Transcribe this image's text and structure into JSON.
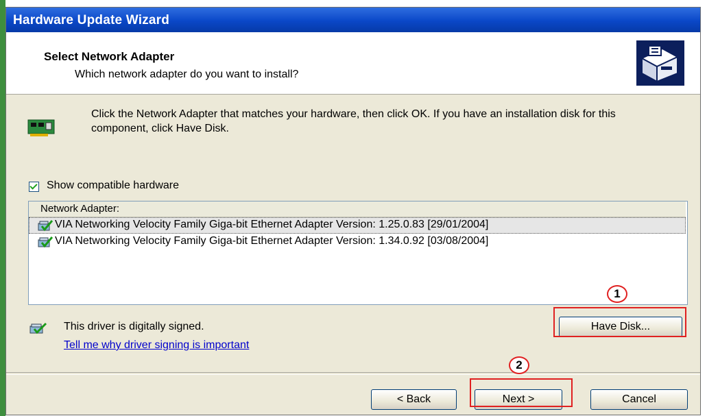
{
  "window": {
    "title": "Hardware Update Wizard"
  },
  "header": {
    "title": "Select Network Adapter",
    "subtitle": "Which network adapter do you want to install?",
    "icon": "hardware-install-icon"
  },
  "intro": {
    "icon": "network-adapter-icon",
    "text": "Click the Network Adapter that matches your hardware, then click OK. If you have an installation disk for this component, click Have Disk."
  },
  "compatible": {
    "label": "Show compatible hardware",
    "checked": true
  },
  "adapter_list": {
    "header": "Network Adapter:",
    "items": [
      {
        "label": "VIA Networking Velocity Family Giga-bit Ethernet Adapter Version: 1.25.0.83 [29/01/2004]",
        "selected": true
      },
      {
        "label": "VIA Networking Velocity Family Giga-bit Ethernet Adapter Version: 1.34.0.92 [03/08/2004]",
        "selected": false
      }
    ]
  },
  "signing": {
    "text": "This driver is digitally signed.",
    "link": "Tell me why driver signing is important"
  },
  "buttons": {
    "have_disk": "Have Disk...",
    "back": "< Back",
    "next": "Next >",
    "cancel": "Cancel"
  },
  "annotations": {
    "step1": "1",
    "step2": "2",
    "highlight_color": "#e02020"
  },
  "colors": {
    "titlebar": "#0a47c8",
    "dialog_bg": "#ece9d8"
  }
}
